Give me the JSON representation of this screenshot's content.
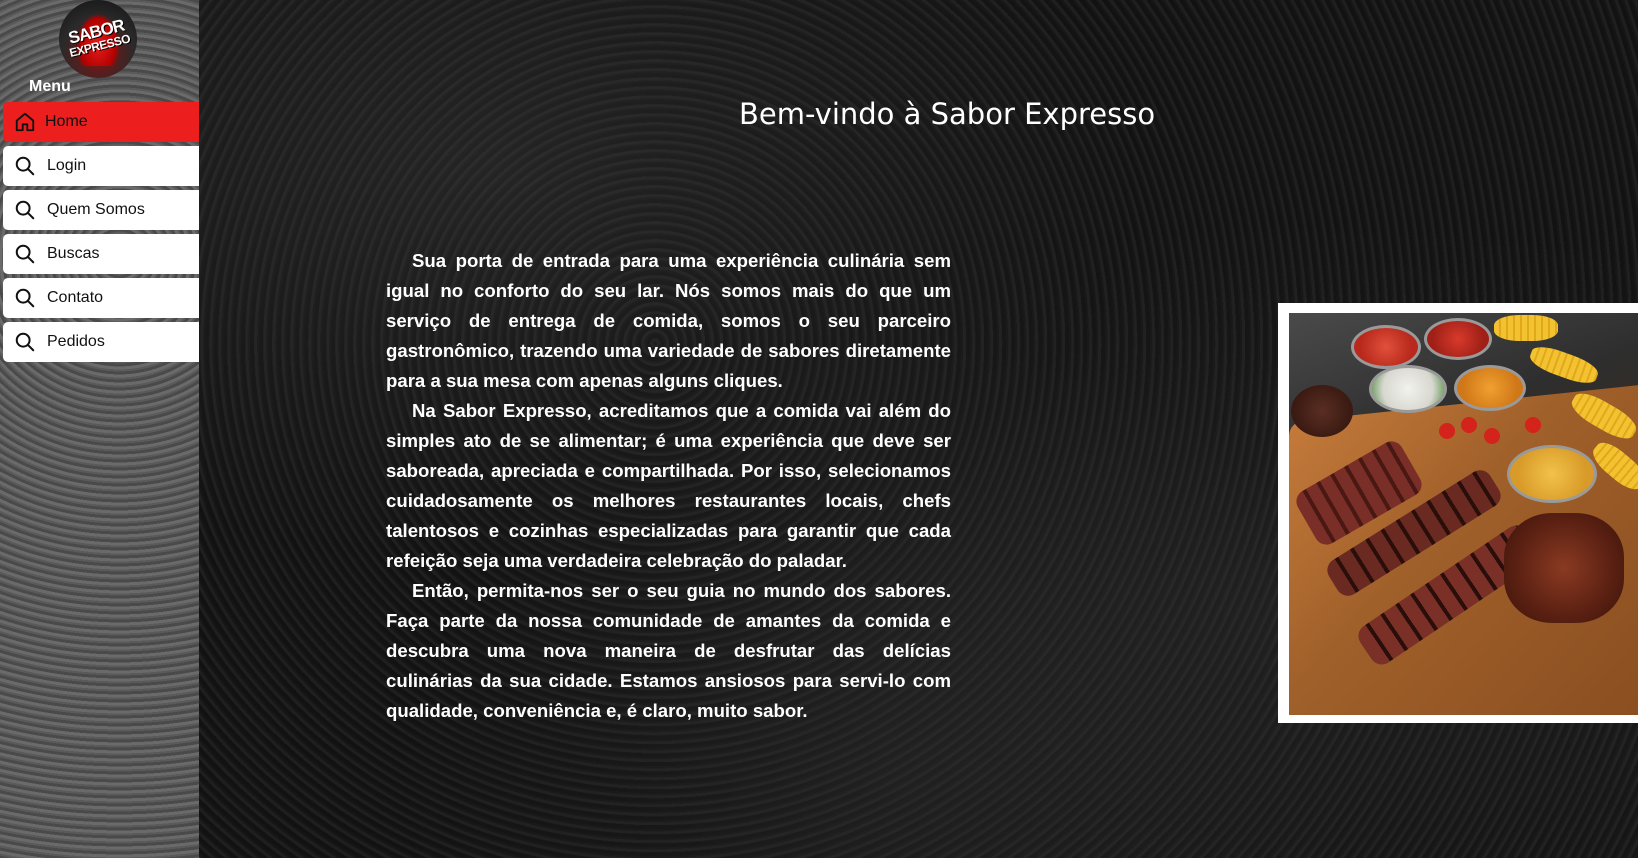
{
  "sidebar": {
    "logo": {
      "line1": "SABOR",
      "line2": "EXPRESSO"
    },
    "menu_title": "Menu",
    "items": [
      {
        "label": "Home",
        "icon": "home-icon",
        "active": true
      },
      {
        "label": "Login",
        "icon": "search-icon",
        "active": false
      },
      {
        "label": "Quem Somos",
        "icon": "search-icon",
        "active": false
      },
      {
        "label": "Buscas",
        "icon": "search-icon",
        "active": false
      },
      {
        "label": "Contato",
        "icon": "search-icon",
        "active": false
      },
      {
        "label": "Pedidos",
        "icon": "search-icon",
        "active": false
      }
    ]
  },
  "main": {
    "title": "Bem-vindo à Sabor Expresso",
    "paragraphs": [
      "Sua porta de entrada para uma experiência culinária sem igual no conforto do seu lar. Nós somos mais do que um serviço de entrega de comida, somos o seu parceiro gastronômico, trazendo uma variedade de sabores diretamente para a sua mesa com apenas alguns cliques.",
      "Na Sabor Expresso, acreditamos que a comida vai além do simples ato de se alimentar; é uma experiência que deve ser saboreada, apreciada e compartilhada. Por isso, selecionamos cuidadosamente os melhores restaurantes locais, chefs talentosos e cozinhas especializadas para garantir que cada refeição seja uma verdadeira celebração do paladar.",
      "Então, permita-nos ser o seu guia no mundo dos sabores. Faça parte da nossa comunidade de amantes da comida e descubra uma nova maneira de desfrutar das delícias culinárias da sua cidade. Estamos ansiosos para servi-lo com qualidade, conveniência e, é claro, muito sabor."
    ]
  },
  "colors": {
    "accent": "#ec1e1e",
    "background": "#171717",
    "sidebar": "#555555",
    "nav_item_bg": "#ffffff"
  }
}
